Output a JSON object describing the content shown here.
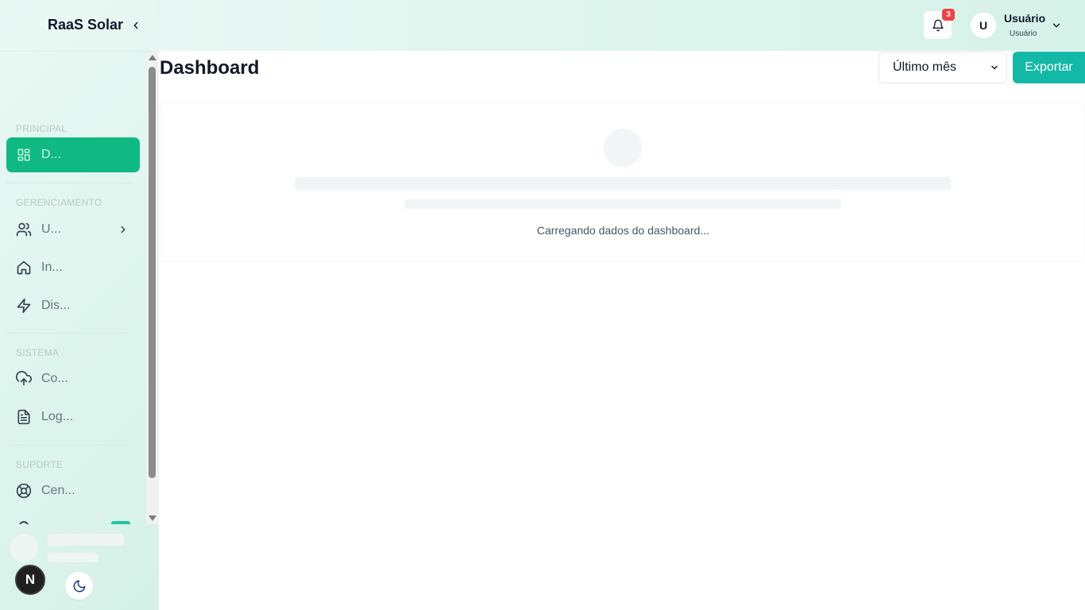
{
  "app": {
    "brand": "RaaS Solar"
  },
  "sidebar": {
    "sections": {
      "principal": "PRINCIPAL",
      "gerenciamento": "GERENCIAMENTO",
      "sistema": "SISTEMA",
      "suporte": "SUPORTE"
    },
    "items": [
      {
        "label": "D...",
        "icon": "dashboard-icon",
        "active": true
      },
      {
        "label": "U...",
        "icon": "users-icon",
        "has_submenu": true
      },
      {
        "label": "In...",
        "icon": "home-icon"
      },
      {
        "label": "Dis...",
        "icon": "lightning-icon"
      },
      {
        "label": "Co...",
        "icon": "cloud-upload-icon"
      },
      {
        "label": "Log...",
        "icon": "file-text-icon"
      },
      {
        "label": "Cen...",
        "icon": "lifebuoy-icon"
      }
    ],
    "footer": {
      "next_badge": "N",
      "theme_icon": "moon-icon"
    }
  },
  "header": {
    "notification_count": "3",
    "user": {
      "initial": "U",
      "name": "Usuário",
      "role": "Usuário"
    }
  },
  "main": {
    "title": "Dashboard",
    "period_select": {
      "selected": "Último mês"
    },
    "export_label": "Exportar",
    "loading_text": "Carregando dados do dashboard..."
  },
  "colors": {
    "accent": "#10b981",
    "export_button": "#14b8a6",
    "notification_badge": "#ef4444"
  }
}
